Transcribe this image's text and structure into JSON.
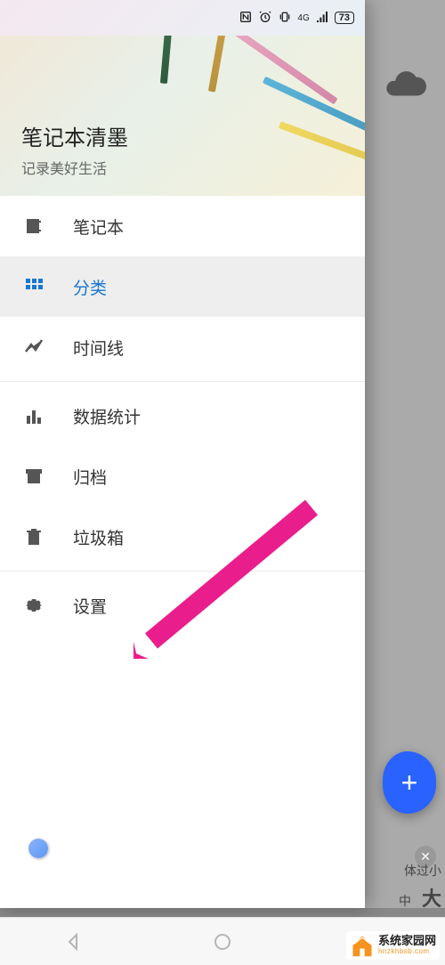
{
  "status": {
    "network": "4G",
    "battery": "73"
  },
  "header": {
    "title": "笔记本清墨",
    "subtitle": "记录美好生活"
  },
  "menu": {
    "notebook": "笔记本",
    "category": "分类",
    "timeline": "时间线",
    "stats": "数据统计",
    "archive": "归档",
    "trash": "垃圾箱",
    "settings": "设置"
  },
  "fab": {
    "plus": "+"
  },
  "sizes": {
    "label": "体过小",
    "mid": "中",
    "big": "大"
  },
  "brand": {
    "name": "系统家园网",
    "url": "hnzkhbsb.com"
  }
}
